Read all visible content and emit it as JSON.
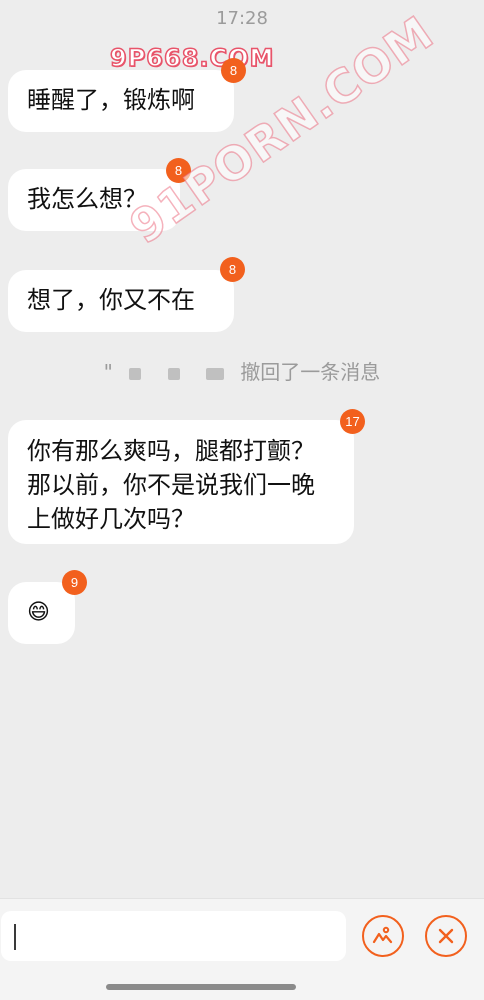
{
  "status": {
    "time": "17:28"
  },
  "watermarks": {
    "top": "9P668.COM",
    "diagonal": "91PORN.COM"
  },
  "messages": [
    {
      "text": "睡醒了，锻炼啊",
      "badge": "8"
    },
    {
      "text": "我怎么想？",
      "badge": "8"
    },
    {
      "text": "想了，你又不在",
      "badge": "8"
    },
    {
      "text": "你有那么爽吗，腿都打颤？那以前，你不是说我们一晚上做好几次吗？",
      "badge": "17"
    },
    {
      "text": "😄",
      "badge": "9"
    }
  ],
  "system_note": {
    "prefix": "\"",
    "suffix": "撤回了一条消息"
  },
  "input": {
    "value": "",
    "placeholder": ""
  },
  "icons": {
    "left_action": "image-icon",
    "right_action": "close-icon"
  },
  "colors": {
    "accent": "#f2601d",
    "background": "#ededed",
    "bubble": "#ffffff"
  }
}
